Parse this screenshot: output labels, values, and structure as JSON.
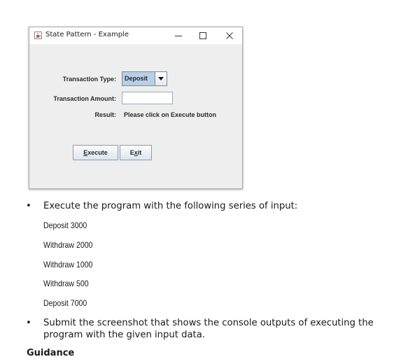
{
  "window": {
    "title": "State Pattern - Example",
    "icon": "java-cup-icon",
    "controls": [
      "minimize-icon",
      "maximize-icon",
      "close-icon"
    ],
    "form": {
      "transaction_type_label": "Transaction Type:",
      "transaction_type_value": "Deposit",
      "transaction_amount_label": "Transaction Amount:",
      "transaction_amount_value": "",
      "result_label": "Result:",
      "result_value": "Please click on Execute button"
    },
    "buttons": {
      "execute_mnemonic": "E",
      "execute_rest": "xecute",
      "exit_first": "E",
      "exit_mnemonic": "x",
      "exit_rest": "it"
    }
  },
  "document": {
    "bullets": [
      {
        "text": "Execute the program with the following series of input:"
      },
      {
        "text": "Submit the screenshot that shows the console outputs of executing the program with the given input data."
      }
    ],
    "bullet_symbol": "•",
    "inputs": [
      "Deposit 3000",
      "Withdraw 2000",
      "Withdraw 1000",
      "Withdraw 500",
      "Deposit 7000"
    ],
    "guidance_heading": "Guidance"
  }
}
